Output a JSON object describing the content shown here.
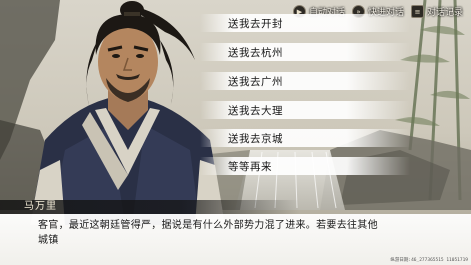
{
  "toolbar": {
    "auto_dialog": "自动对话",
    "fast_dialog": "快进对话",
    "dialog_log": "对话记录"
  },
  "choices": [
    "送我去开封",
    "送我去杭州",
    "送我去广州",
    "送我去大理",
    "送我去京城",
    "等等再来"
  ],
  "dialogue": {
    "speaker": "马万里",
    "text": "客官，最近这朝廷管得严，据说是有什么外部势力混了进来。若要去往其他城镇"
  },
  "build_info": "纵游日期:46_277365515 11051719",
  "icons": {
    "auto": "play-icon",
    "fast": "fast-forward-icon",
    "log": "log-icon"
  }
}
